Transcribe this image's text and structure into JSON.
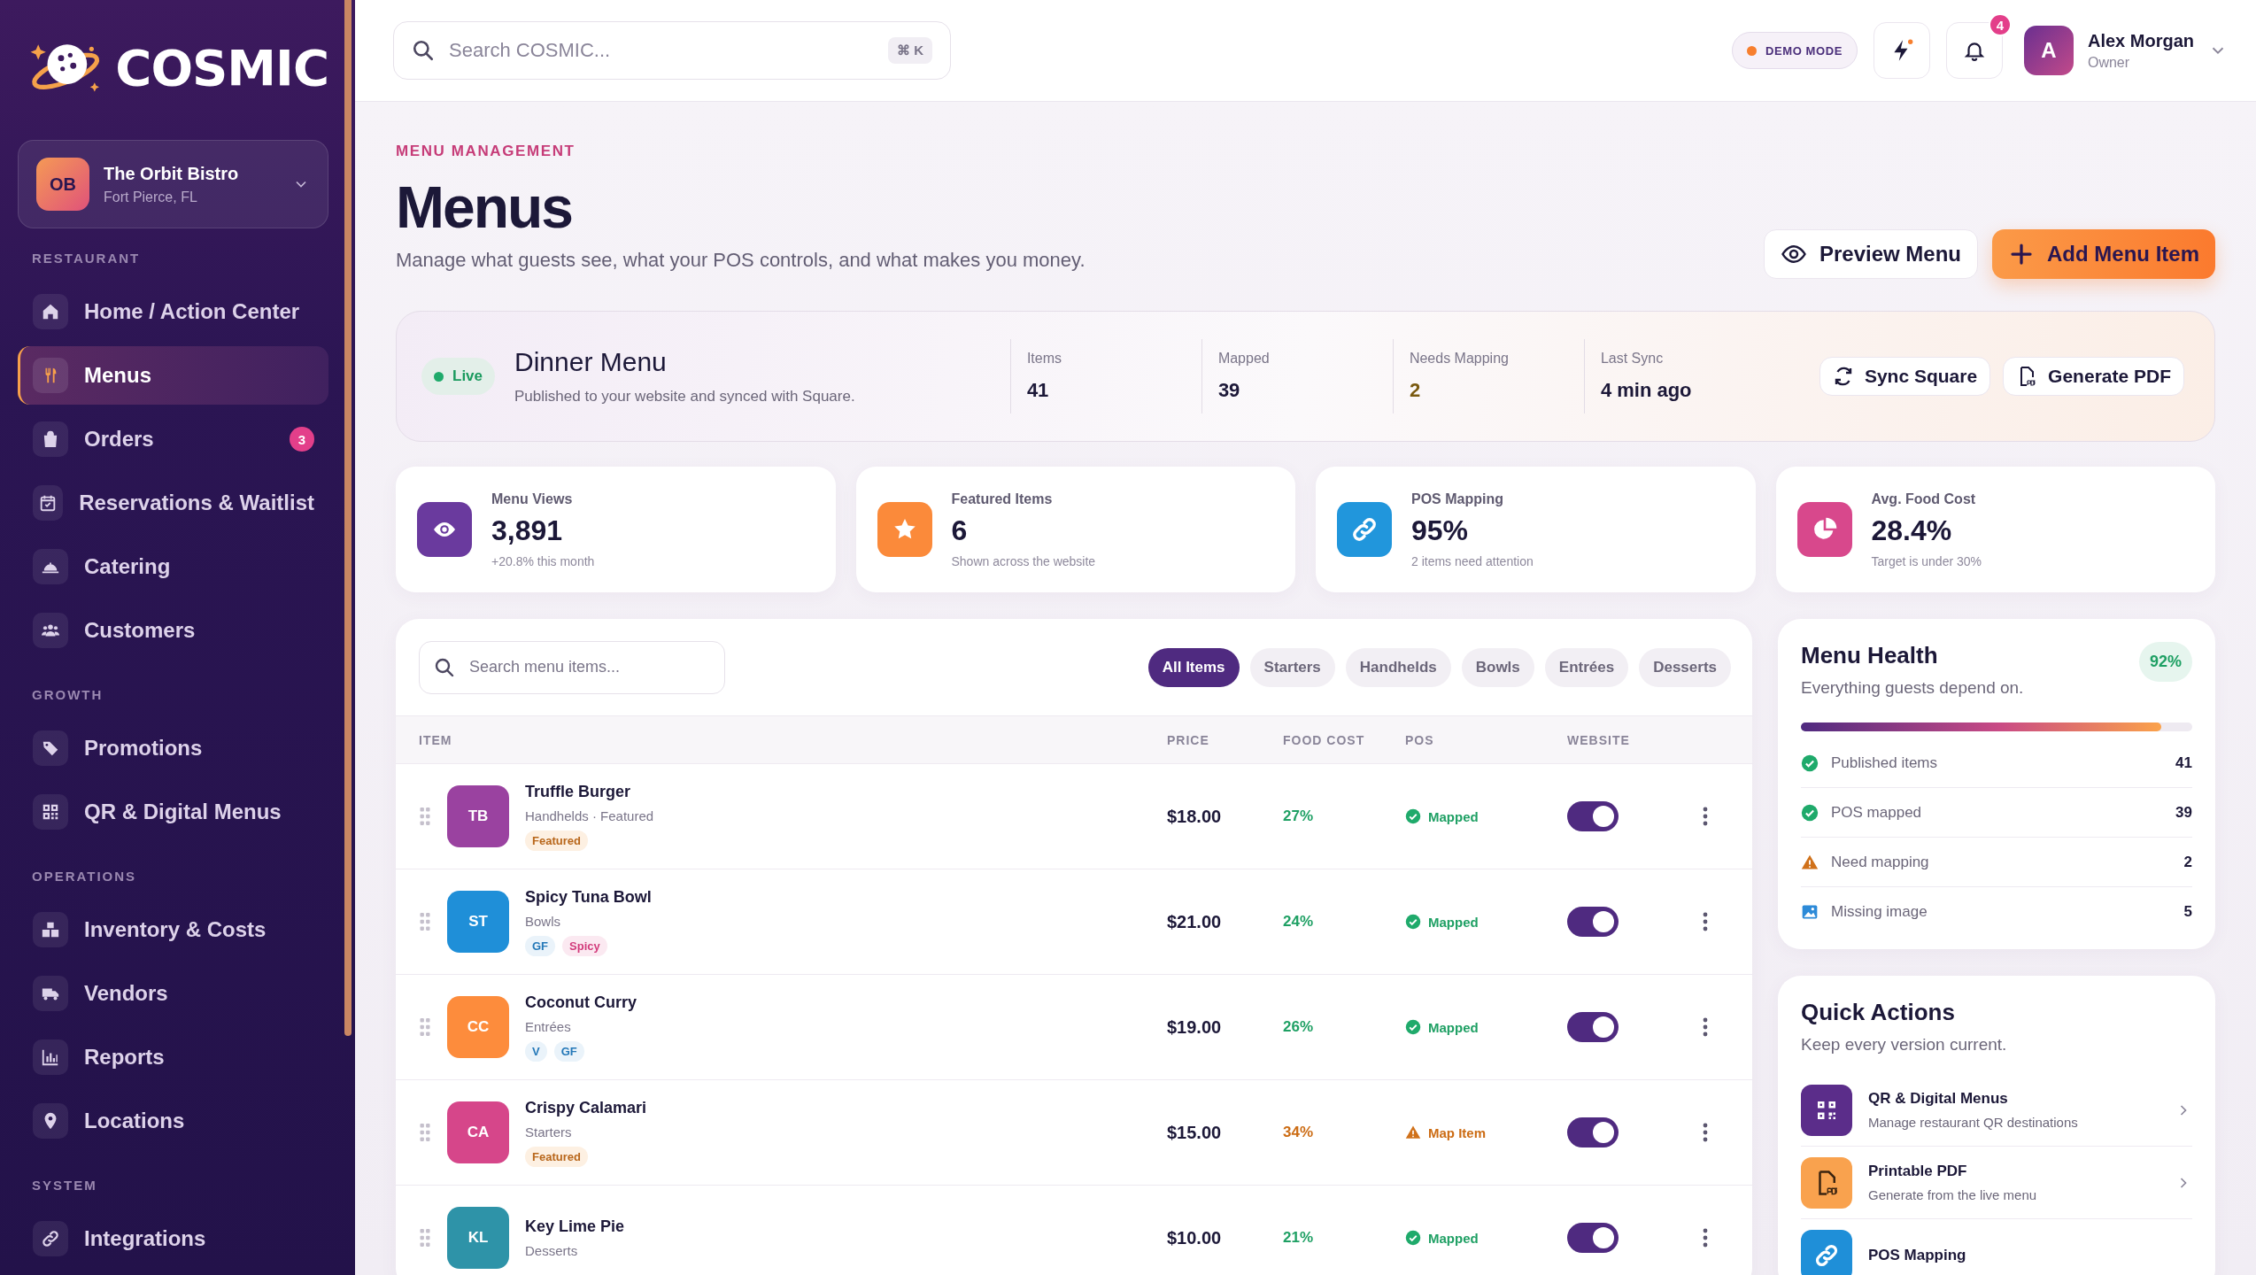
{
  "brand": {
    "name": "COSMIC"
  },
  "restaurant": {
    "initials": "OB",
    "name": "The Orbit Bistro",
    "location": "Fort Pierce, FL"
  },
  "nav": [
    {
      "section": "RESTAURANT",
      "items": [
        {
          "label": "Home / Action Center",
          "selected": false
        },
        {
          "label": "Menus",
          "selected": true
        },
        {
          "label": "Orders",
          "selected": false,
          "badge": "3"
        },
        {
          "label": "Reservations & Waitlist",
          "selected": false
        },
        {
          "label": "Catering",
          "selected": false
        },
        {
          "label": "Customers",
          "selected": false
        }
      ]
    },
    {
      "section": "GROWTH",
      "items": [
        {
          "label": "Promotions",
          "selected": false
        },
        {
          "label": "QR & Digital Menus",
          "selected": false
        }
      ]
    },
    {
      "section": "OPERATIONS",
      "items": [
        {
          "label": "Inventory & Costs",
          "selected": false
        },
        {
          "label": "Vendors",
          "selected": false
        },
        {
          "label": "Reports",
          "selected": false
        },
        {
          "label": "Locations",
          "selected": false
        }
      ]
    },
    {
      "section": "SYSTEM",
      "items": [
        {
          "label": "Integrations",
          "selected": false
        }
      ]
    }
  ],
  "search": {
    "placeholder": "Search COSMIC...",
    "shortcut": "⌘ K"
  },
  "demo_mode": {
    "label": "DEMO MODE"
  },
  "notifications": {
    "count": "4"
  },
  "user": {
    "initial": "A",
    "name": "Alex Morgan",
    "role": "Owner"
  },
  "header": {
    "eyebrow": "MENU MANAGEMENT",
    "title": "Menus",
    "subtitle": "Manage what guests see, what your POS controls, and what makes you money.",
    "buttons": [
      {
        "label": "Preview Menu",
        "kind": "secondary"
      },
      {
        "label": "Add Menu Item",
        "kind": "primary"
      }
    ]
  },
  "menu_card": {
    "status": "Live",
    "name": "Dinner Menu",
    "description": "Published to your website and synced with Square.",
    "stats": [
      {
        "label": "Items",
        "value": "41",
        "kind": "plain"
      },
      {
        "label": "Mapped",
        "value": "39",
        "kind": "plain"
      },
      {
        "label": "Needs Mapping",
        "value": "2",
        "kind": "warning"
      },
      {
        "label": "Last Sync",
        "value": "4 min ago",
        "kind": "plain"
      }
    ],
    "buttons": [
      "Sync Square",
      "Generate PDF"
    ]
  },
  "metrics": [
    {
      "label": "Menu Views",
      "value": "3,891",
      "note": "+20.8% this month",
      "color": "#6a3a9e"
    },
    {
      "label": "Featured Items",
      "value": "6",
      "note": "Shown across the website",
      "color": "#fb8a3a"
    },
    {
      "label": "POS Mapping",
      "value": "95%",
      "note": "2 items need attention",
      "color": "#2196dc"
    },
    {
      "label": "Avg. Food Cost",
      "value": "28.4%",
      "note": "Target is under 30%",
      "color": "#d8488c"
    }
  ],
  "item_search": {
    "placeholder": "Search menu items..."
  },
  "filters": [
    {
      "label": "All Items",
      "selected": true
    },
    {
      "label": "Starters",
      "selected": false
    },
    {
      "label": "Handhelds",
      "selected": false
    },
    {
      "label": "Bowls",
      "selected": false
    },
    {
      "label": "Entrées",
      "selected": false
    },
    {
      "label": "Desserts",
      "selected": false
    }
  ],
  "table": {
    "columns": [
      "ITEM",
      "PRICE",
      "FOOD COST",
      "POS",
      "WEBSITE"
    ],
    "rows": [
      {
        "initials": "TB",
        "color": "#9a42a0",
        "name": "Truffle Burger",
        "category": "Handhelds · Featured",
        "tags": [
          {
            "label": "Featured",
            "kind": "featured"
          }
        ],
        "price": "$18.00",
        "food_cost": {
          "value": "27%",
          "kind": "good"
        },
        "pos": {
          "label": "Mapped",
          "kind": "mapped"
        },
        "website": true
      },
      {
        "initials": "ST",
        "color": "#1f8fd8",
        "name": "Spicy Tuna Bowl",
        "category": "Bowls",
        "tags": [
          {
            "label": "GF",
            "kind": "diet"
          },
          {
            "label": "Spicy",
            "kind": "spicy"
          }
        ],
        "price": "$21.00",
        "food_cost": {
          "value": "24%",
          "kind": "good"
        },
        "pos": {
          "label": "Mapped",
          "kind": "mapped"
        },
        "website": true
      },
      {
        "initials": "CC",
        "color": "#fd8c3c",
        "name": "Coconut Curry",
        "category": "Entrées",
        "tags": [
          {
            "label": "V",
            "kind": "diet"
          },
          {
            "label": "GF",
            "kind": "diet"
          }
        ],
        "price": "$19.00",
        "food_cost": {
          "value": "26%",
          "kind": "good"
        },
        "pos": {
          "label": "Mapped",
          "kind": "mapped"
        },
        "website": true
      },
      {
        "initials": "CA",
        "color": "#d6468a",
        "name": "Crispy Calamari",
        "category": "Starters",
        "tags": [
          {
            "label": "Featured",
            "kind": "featured"
          }
        ],
        "price": "$15.00",
        "food_cost": {
          "value": "34%",
          "kind": "high"
        },
        "pos": {
          "label": "Map Item",
          "kind": "unmapped"
        },
        "website": true
      },
      {
        "initials": "KL",
        "color": "#2e93a8",
        "name": "Key Lime Pie",
        "category": "Desserts",
        "tags": [],
        "price": "$10.00",
        "food_cost": {
          "value": "21%",
          "kind": "good"
        },
        "pos": {
          "label": "Mapped",
          "kind": "mapped"
        },
        "website": true
      }
    ]
  },
  "health": {
    "title": "Menu Health",
    "subtitle": "Everything guests depend on.",
    "score": "92%",
    "level": 0.92,
    "rows": [
      {
        "label": "Published items",
        "value": "41",
        "kind": "ok"
      },
      {
        "label": "POS mapped",
        "value": "39",
        "kind": "ok"
      },
      {
        "label": "Need mapping",
        "value": "2",
        "kind": "warning"
      },
      {
        "label": "Missing image",
        "value": "5",
        "kind": "image"
      }
    ]
  },
  "quick_actions": {
    "title": "Quick Actions",
    "subtitle": "Keep every version current.",
    "items": [
      {
        "title": "QR & Digital Menus",
        "subtitle": "Manage restaurant QR destinations",
        "color": "#5b2d8a"
      },
      {
        "title": "Printable PDF",
        "subtitle": "Generate from the live menu",
        "color": "#f9a24e"
      },
      {
        "title": "POS Mapping",
        "color": "#1f8fd8"
      }
    ]
  }
}
